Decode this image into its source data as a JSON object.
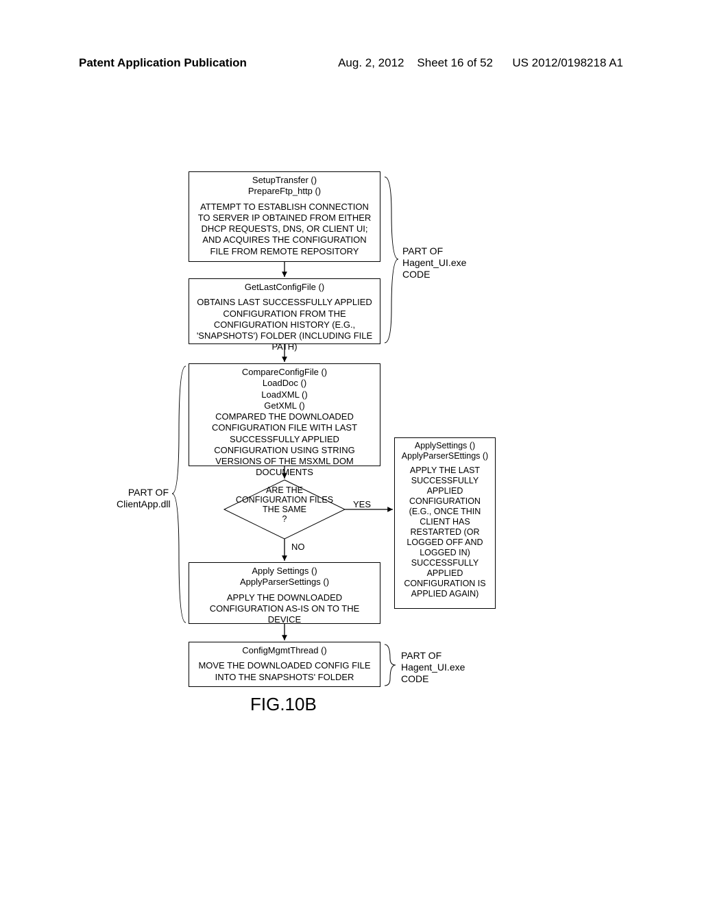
{
  "header": {
    "left": "Patent Application Publication",
    "date": "Aug. 2, 2012",
    "sheet": "Sheet 16 of 52",
    "pubnum": "US 2012/0198218 A1"
  },
  "labels": {
    "part_of_clientapp": "PART OF\nClientApp.dll",
    "part_of_hagent_top": "PART OF\nHagent_UI.exe\nCODE",
    "part_of_hagent_bottom": "PART OF\nHagent_UI.exe\nCODE",
    "yes": "YES",
    "no": "NO",
    "figure": "FIG.10B"
  },
  "blocks": {
    "setup": {
      "head": "SetupTransfer ()\nPrepareFtp_http ()",
      "body": "ATTEMPT TO ESTABLISH CONNECTION TO SERVER IP OBTAINED FROM EITHER DHCP REQUESTS, DNS, OR CLIENT UI; AND ACQUIRES THE CONFIGURATION FILE FROM REMOTE REPOSITORY"
    },
    "getlast": {
      "head": "GetLastConfigFile ()",
      "body": "OBTAINS LAST SUCCESSFULLY APPLIED CONFIGURATION FROM THE CONFIGURATION HISTORY (E.G., 'SNAPSHOTS') FOLDER (INCLUDING FILE PATH)"
    },
    "compare": {
      "head": "CompareConfigFile ()\nLoadDoc ()\nLoadXML ()\nGetXML ()",
      "body": "COMPARED THE DOWNLOADED CONFIGURATION FILE WITH LAST SUCCESSFULLY APPLIED CONFIGURATION USING STRING VERSIONS OF THE MSXML DOM DOCUMENTS"
    },
    "decision": "ARE THE\nCONFIGURATION FILES\nTHE SAME\n?",
    "applydown": {
      "head": "Apply Settings ()\nApplyParserSettings ()",
      "body": "APPLY THE DOWNLOADED CONFIGURATION AS-IS ON TO THE DEVICE"
    },
    "applylast": {
      "head": "ApplySettings ()\nApplyParserSEttings ()",
      "body": "APPLY THE LAST SUCCESSFULLY APPLIED CONFIGURATION (E.G., ONCE THIN CLIENT HAS RESTARTED (OR LOGGED OFF AND LOGGED IN) SUCCESSFULLY APPLIED CONFIGURATION IS APPLIED AGAIN)"
    },
    "configmgmt": {
      "head": "ConfigMgmtThread ()",
      "body": "MOVE THE DOWNLOADED CONFIG FILE INTO THE SNAPSHOTS' FOLDER"
    }
  }
}
